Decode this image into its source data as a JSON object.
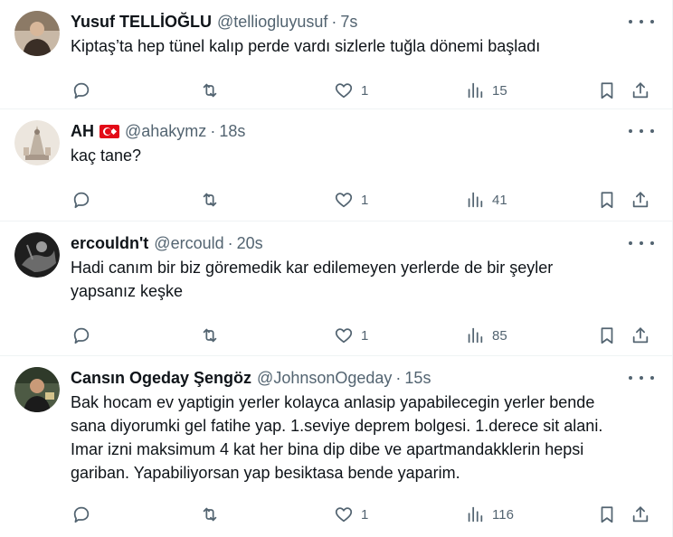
{
  "tweets": [
    {
      "name": "Yusuf TELLİOĞLU",
      "handle": "@telliogluyusuf",
      "time": "7s",
      "text": "Kiptaş’ta hep tünel kalıp perde vardı sizlerle tuğla dönemi başladı",
      "replies": "",
      "retweets": "",
      "likes": "1",
      "views": "15",
      "avatar_color": "#5a4a3a"
    },
    {
      "name": "AH",
      "flag": "turkey-flag-icon",
      "handle": "@ahakymz",
      "time": "18s",
      "text": "kaç tane?",
      "replies": "",
      "retweets": "",
      "likes": "1",
      "views": "41",
      "avatar_color": "#d9cfc4"
    },
    {
      "name": "ercouldn't",
      "handle": "@ercould",
      "time": "20s",
      "text": "Hadi canım bir biz göremedik kar edilemeyen yerlerde de bir şeyler\nyapsanız keşke",
      "replies": "",
      "retweets": "",
      "likes": "1",
      "views": "85",
      "avatar_color": "#2a2a2a"
    },
    {
      "name": "Cansın Ogeday Şengöz",
      "handle": "@JohnsonOgeday",
      "time": "15s",
      "text": "Bak hocam ev yaptigin yerler kolayca anlasip yapabilecegin yerler bende\nsana diyorumki gel fatihe yap. 1.seviye deprem bolgesi. 1.derece sit alani.\nImar izni maksimum 4 kat her bina dip dibe ve apartmandakklerin hepsi\ngariban. Yapabiliyorsan yap besiktasa bende yaparim.",
      "replies": "",
      "retweets": "",
      "likes": "1",
      "views": "116",
      "avatar_color": "#3b4a3a"
    }
  ],
  "separator": "·"
}
